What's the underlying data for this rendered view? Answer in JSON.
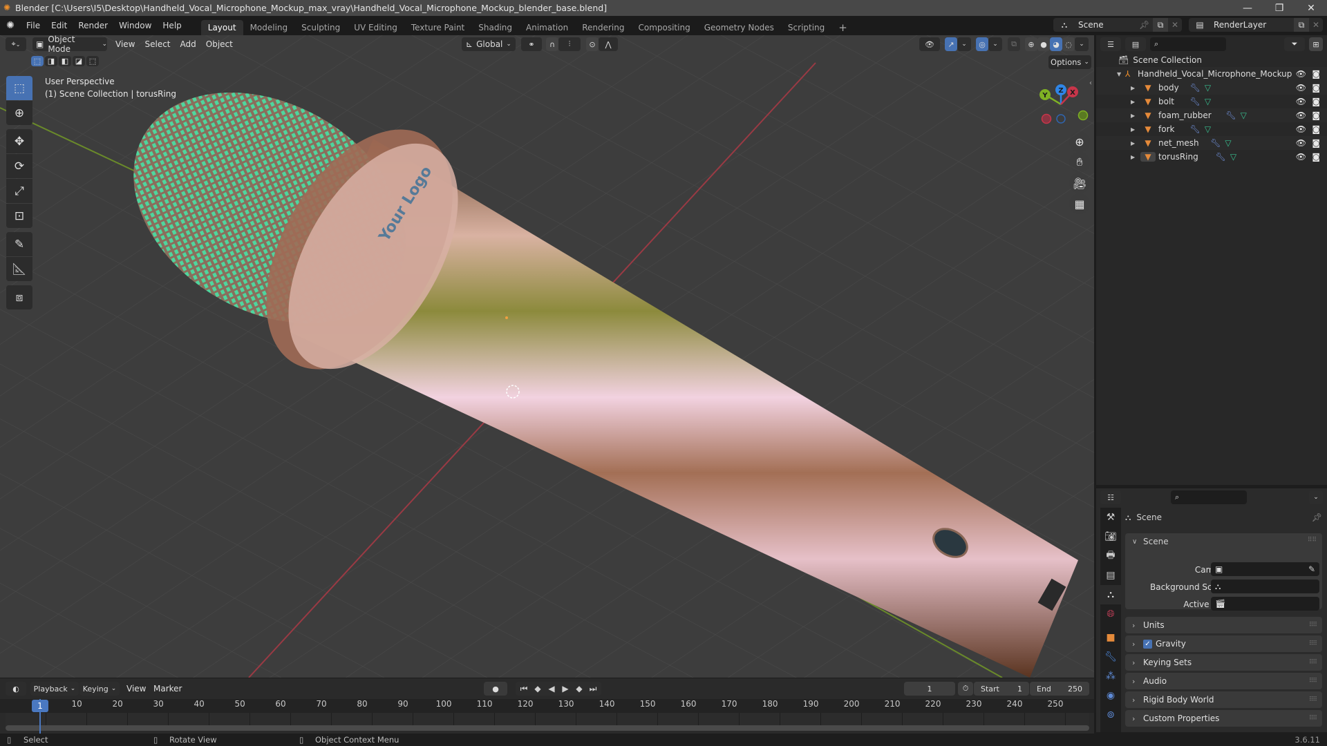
{
  "window": {
    "title": "Blender [C:\\Users\\I5\\Desktop\\Handheld_Vocal_Microphone_Mockup_max_vray\\Handheld_Vocal_Microphone_Mockup_blender_base.blend]",
    "minimize": "—",
    "maximize": "❐",
    "close": "✕"
  },
  "menubar": {
    "items": [
      "File",
      "Edit",
      "Render",
      "Window",
      "Help"
    ],
    "workspaces": [
      "Layout",
      "Modeling",
      "Sculpting",
      "UV Editing",
      "Texture Paint",
      "Shading",
      "Animation",
      "Rendering",
      "Compositing",
      "Geometry Nodes",
      "Scripting"
    ],
    "active_workspace": "Layout",
    "add_workspace": "+",
    "scene": "Scene",
    "view_layer": "RenderLayer"
  },
  "viewport": {
    "mode": "Object Mode",
    "menus": [
      "View",
      "Select",
      "Add",
      "Object"
    ],
    "transform_orientation": "Global",
    "options_label": "Options",
    "overlay_title": "User Perspective",
    "overlay_subtitle": "(1) Scene Collection | torusRing",
    "gizmo": {
      "x": "X",
      "y": "Y",
      "z": "Z"
    },
    "logo_text": "Your Logo",
    "colors": {
      "accent": "#4772b3",
      "x_axis": "#c8354a",
      "y_axis": "#7fb124",
      "z_axis": "#2f85e6",
      "mesh_green": "#3fd698"
    }
  },
  "outliner": {
    "search_placeholder": "",
    "root": "Scene Collection",
    "collection": "Handheld_Vocal_Microphone_Mockup",
    "objects": [
      {
        "name": "body"
      },
      {
        "name": "bolt"
      },
      {
        "name": "foam_rubber"
      },
      {
        "name": "fork"
      },
      {
        "name": "net_mesh"
      },
      {
        "name": "torusRing",
        "active": true
      }
    ]
  },
  "properties": {
    "search_placeholder": "",
    "context": "Scene",
    "section_scene": "Scene",
    "fields": [
      {
        "label": "Camera",
        "value": ""
      },
      {
        "label": "Background Scene",
        "value": ""
      },
      {
        "label": "Active Clip",
        "value": ""
      }
    ],
    "panels": [
      {
        "label": "Units"
      },
      {
        "label": "Gravity",
        "checkbox": true,
        "checked": true
      },
      {
        "label": "Keying Sets"
      },
      {
        "label": "Audio"
      },
      {
        "label": "Rigid Body World"
      },
      {
        "label": "Custom Properties"
      }
    ]
  },
  "timeline": {
    "menus": [
      "Playback",
      "Keying",
      "View",
      "Marker"
    ],
    "current_frame": "1",
    "start_label": "Start",
    "start": "1",
    "end_label": "End",
    "end": "250",
    "ticks": [
      "10",
      "20",
      "30",
      "40",
      "50",
      "60",
      "70",
      "80",
      "90",
      "100",
      "110",
      "120",
      "130",
      "140",
      "150",
      "160",
      "170",
      "180",
      "190",
      "200",
      "210",
      "220",
      "230",
      "240",
      "250"
    ],
    "playhead": "1"
  },
  "statusbar": {
    "select": "Select",
    "rotate": "Rotate View",
    "context_menu": "Object Context Menu",
    "version": "3.6.11"
  }
}
